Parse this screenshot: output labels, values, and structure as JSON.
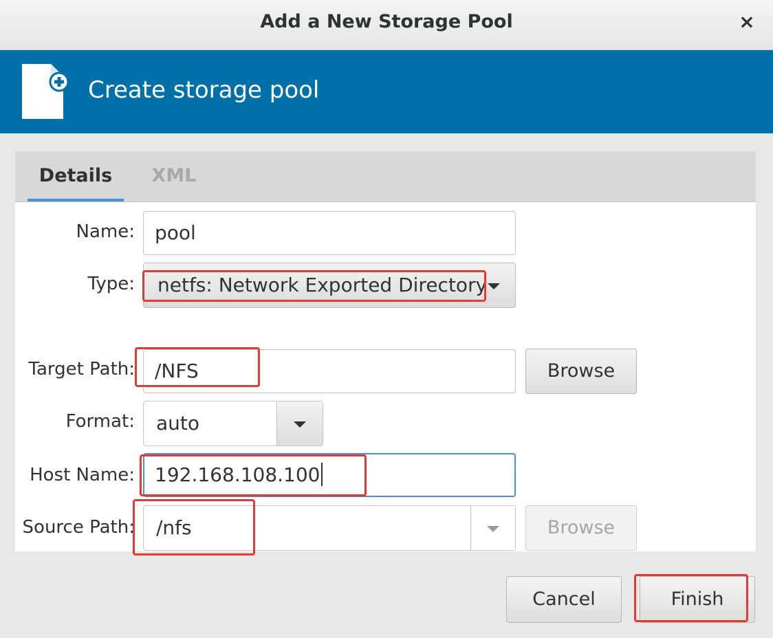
{
  "window": {
    "title": "Add a New Storage Pool",
    "close_glyph": "×"
  },
  "banner": {
    "heading": "Create storage pool",
    "icon": "document-add-icon"
  },
  "tabs": [
    {
      "label": "Details",
      "active": true
    },
    {
      "label": "XML",
      "active": false
    }
  ],
  "form": {
    "name": {
      "label": "Name:",
      "value": "pool"
    },
    "type": {
      "label": "Type:",
      "value": "netfs: Network Exported Directory"
    },
    "target_path": {
      "label": "Target Path:",
      "value": "/NFS",
      "browse": "Browse"
    },
    "format": {
      "label": "Format:",
      "value": "auto"
    },
    "host_name": {
      "label": "Host Name:",
      "value": "192.168.108.100"
    },
    "source_path": {
      "label": "Source Path:",
      "value": "/nfs",
      "browse": "Browse"
    }
  },
  "actions": {
    "cancel": "Cancel",
    "finish": "Finish"
  },
  "colors": {
    "banner": "#0071a8",
    "focus": "#4a90d9",
    "highlight": "#e53935"
  }
}
